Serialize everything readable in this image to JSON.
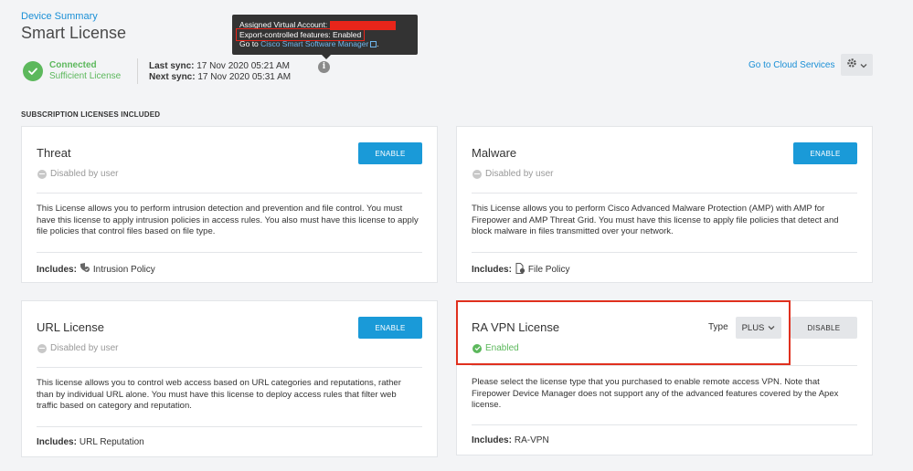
{
  "header": {
    "breadcrumb": "Device Summary",
    "title": "Smart License"
  },
  "status": {
    "line1": "Connected",
    "line2": "Sufficient License"
  },
  "sync": {
    "last_label": "Last sync:",
    "last_value": "17 Nov 2020 05:21 AM",
    "next_label": "Next sync:",
    "next_value": "17 Nov 2020 05:31 AM"
  },
  "tooltip": {
    "account_label": "Assigned Virtual Account:",
    "export_text": "Export-controlled features: Enabled",
    "goto_prefix": "Go to",
    "goto_link": "Cisco Smart Software Manager",
    "goto_suffix": "."
  },
  "top_right": {
    "cloud_link": "Go to Cloud Services"
  },
  "section": {
    "title": "SUBSCRIPTION LICENSES INCLUDED"
  },
  "cards": [
    {
      "title": "Threat",
      "status": "Disabled by user",
      "button": "ENABLE",
      "description": "This License allows you to perform intrusion detection and prevention and file control. You must have this license to apply intrusion policies in access rules. You also must have this license to apply file policies that control files based on file type.",
      "includes_label": "Includes:",
      "includes_value": "Intrusion Policy"
    },
    {
      "title": "Malware",
      "status": "Disabled by user",
      "button": "ENABLE",
      "description": "This License allows you to perform Cisco Advanced Malware Protection (AMP) with AMP for Firepower and AMP Threat Grid. You must have this license to apply file policies that detect and block malware in files transmitted over your network.",
      "includes_label": "Includes:",
      "includes_value": "File Policy"
    },
    {
      "title": "URL License",
      "status": "Disabled by user",
      "button": "ENABLE",
      "description": "This license allows you to control web access based on URL categories and reputations, rather than by individual URL alone. You must have this license to deploy access rules that filter web traffic based on category and reputation.",
      "includes_label": "Includes:",
      "includes_value": "URL Reputation"
    },
    {
      "title": "RA VPN License",
      "status": "Enabled",
      "button": "DISABLE",
      "type_label": "Type",
      "type_value": "PLUS",
      "description": "Please select the license type that you purchased to enable remote access VPN. Note that Firepower Device Manager does not support any of the advanced features covered by the Apex license.",
      "includes_label": "Includes:",
      "includes_value": "RA-VPN"
    }
  ],
  "colors": {
    "accent": "#1a9ad8",
    "success": "#5cb85c",
    "highlight": "#e0301e"
  }
}
